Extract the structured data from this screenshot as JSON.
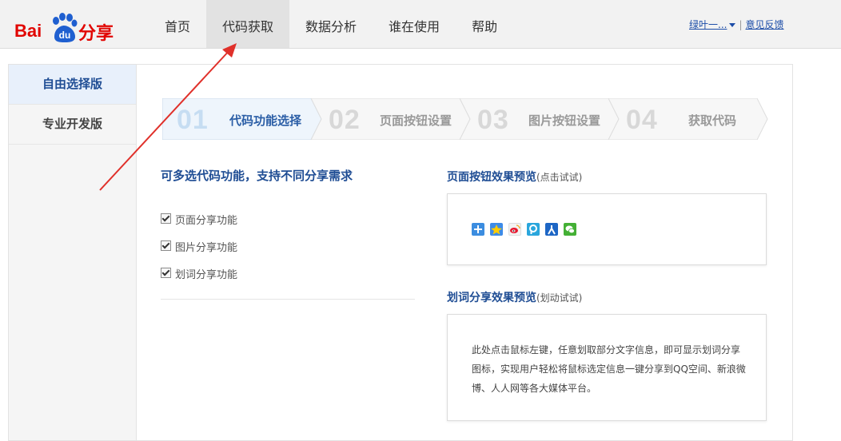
{
  "brand": {
    "logo_left": "Bai",
    "logo_du": "du",
    "logo_right": "分享",
    "color": "#e10602"
  },
  "nav": {
    "items": [
      {
        "label": "首页"
      },
      {
        "label": "代码获取"
      },
      {
        "label": "数据分析"
      },
      {
        "label": "谁在使用"
      },
      {
        "label": "帮助"
      }
    ],
    "active_index": 1
  },
  "user": {
    "name": "绿叶一...",
    "feedback": "意见反馈",
    "separator": "|"
  },
  "sidebar": {
    "items": [
      {
        "label": "自由选择版"
      },
      {
        "label": "专业开发版"
      }
    ]
  },
  "steps": [
    {
      "num": "01",
      "label": "代码功能选择"
    },
    {
      "num": "02",
      "label": "页面按钮设置"
    },
    {
      "num": "03",
      "label": "图片按钮设置"
    },
    {
      "num": "04",
      "label": "获取代码"
    }
  ],
  "features": {
    "title": "可多选代码功能，支持不同分享需求",
    "options": [
      {
        "label": "页面分享功能",
        "checked": true
      },
      {
        "label": "图片分享功能",
        "checked": true
      },
      {
        "label": "划词分享功能",
        "checked": true
      }
    ]
  },
  "button_preview": {
    "title": "页面按钮效果预览",
    "hint": "(点击试试)",
    "icons": [
      "more-plus-icon",
      "qzone-star-icon",
      "weibo-icon",
      "tencent-weibo-icon",
      "renren-icon",
      "wechat-icon"
    ]
  },
  "text_preview": {
    "title": "划词分享效果预览",
    "hint": "(划动试试)",
    "sample": "此处点击鼠标左键，任意划取部分文字信息，即可显示划词分享图标，实现用户轻松将鼠标选定信息一键分享到QQ空间、新浪微博、人人网等各大媒体平台。"
  },
  "colors": {
    "accent": "#1f4d94",
    "annotation_arrow": "#e0302a"
  }
}
